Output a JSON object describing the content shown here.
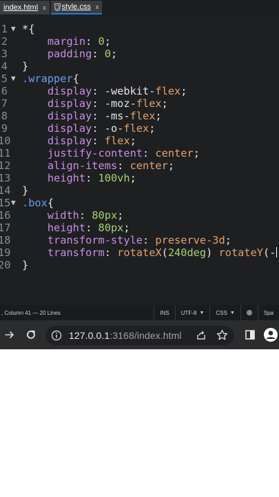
{
  "tabs": [
    {
      "label": "index.html",
      "close": "x",
      "active": false
    },
    {
      "label": "style.css",
      "close": "x",
      "active": true
    }
  ],
  "editor": {
    "lines": [
      {
        "n": "1",
        "fold": "▼",
        "tokens": [
          [
            "t-punc",
            "*{"
          ]
        ]
      },
      {
        "n": "2",
        "fold": "",
        "tokens": [
          [
            "t-punc",
            "    "
          ],
          [
            "t-prop",
            "margin"
          ],
          [
            "t-punc",
            ": "
          ],
          [
            "t-num",
            "0"
          ],
          [
            "t-punc",
            ";"
          ]
        ]
      },
      {
        "n": "3",
        "fold": "",
        "tokens": [
          [
            "t-punc",
            "    "
          ],
          [
            "t-prop",
            "padding"
          ],
          [
            "t-punc",
            ": "
          ],
          [
            "t-num",
            "0"
          ],
          [
            "t-punc",
            ";"
          ]
        ]
      },
      {
        "n": "4",
        "fold": "",
        "tokens": [
          [
            "t-punc",
            "}"
          ]
        ]
      },
      {
        "n": "5",
        "fold": "▼",
        "tokens": [
          [
            "t-sel",
            ".wrapper"
          ],
          [
            "t-punc",
            "{"
          ]
        ]
      },
      {
        "n": "6",
        "fold": "",
        "tokens": [
          [
            "t-punc",
            "    "
          ],
          [
            "t-prop",
            "display"
          ],
          [
            "t-punc",
            ": "
          ],
          [
            "t-punc",
            "-webkit-"
          ],
          [
            "t-val",
            "flex"
          ],
          [
            "t-punc",
            ";"
          ]
        ]
      },
      {
        "n": "7",
        "fold": "",
        "tokens": [
          [
            "t-punc",
            "    "
          ],
          [
            "t-prop",
            "display"
          ],
          [
            "t-punc",
            ": "
          ],
          [
            "t-punc",
            "-moz-"
          ],
          [
            "t-val",
            "flex"
          ],
          [
            "t-punc",
            ";"
          ]
        ]
      },
      {
        "n": "8",
        "fold": "",
        "tokens": [
          [
            "t-punc",
            "    "
          ],
          [
            "t-prop",
            "display"
          ],
          [
            "t-punc",
            ": "
          ],
          [
            "t-punc",
            "-ms-"
          ],
          [
            "t-val",
            "flex"
          ],
          [
            "t-punc",
            ";"
          ]
        ]
      },
      {
        "n": "9",
        "fold": "",
        "tokens": [
          [
            "t-punc",
            "    "
          ],
          [
            "t-prop",
            "display"
          ],
          [
            "t-punc",
            ": "
          ],
          [
            "t-punc",
            "-o-"
          ],
          [
            "t-val",
            "flex"
          ],
          [
            "t-punc",
            ";"
          ]
        ]
      },
      {
        "n": "10",
        "fold": "",
        "tokens": [
          [
            "t-punc",
            "    "
          ],
          [
            "t-prop",
            "display"
          ],
          [
            "t-punc",
            ": "
          ],
          [
            "t-val",
            "flex"
          ],
          [
            "t-punc",
            ";"
          ]
        ]
      },
      {
        "n": "11",
        "fold": "",
        "tokens": [
          [
            "t-punc",
            "    "
          ],
          [
            "t-prop",
            "justify-content"
          ],
          [
            "t-punc",
            ": "
          ],
          [
            "t-val",
            "center"
          ],
          [
            "t-punc",
            ";"
          ]
        ]
      },
      {
        "n": "12",
        "fold": "",
        "tokens": [
          [
            "t-punc",
            "    "
          ],
          [
            "t-prop",
            "align-items"
          ],
          [
            "t-punc",
            ": "
          ],
          [
            "t-val",
            "center"
          ],
          [
            "t-punc",
            ";"
          ]
        ]
      },
      {
        "n": "13",
        "fold": "",
        "tokens": [
          [
            "t-punc",
            "    "
          ],
          [
            "t-prop",
            "height"
          ],
          [
            "t-punc",
            ": "
          ],
          [
            "t-num",
            "100vh"
          ],
          [
            "t-punc",
            ";"
          ]
        ]
      },
      {
        "n": "14",
        "fold": "",
        "tokens": [
          [
            "t-punc",
            "}"
          ]
        ]
      },
      {
        "n": "15",
        "fold": "▼",
        "tokens": [
          [
            "t-sel",
            ".box"
          ],
          [
            "t-punc",
            "{"
          ]
        ]
      },
      {
        "n": "16",
        "fold": "",
        "tokens": [
          [
            "t-punc",
            "    "
          ],
          [
            "t-prop",
            "width"
          ],
          [
            "t-punc",
            ": "
          ],
          [
            "t-num",
            "80px"
          ],
          [
            "t-punc",
            ";"
          ]
        ]
      },
      {
        "n": "17",
        "fold": "",
        "tokens": [
          [
            "t-punc",
            "    "
          ],
          [
            "t-prop",
            "height"
          ],
          [
            "t-punc",
            ": "
          ],
          [
            "t-num",
            "80px"
          ],
          [
            "t-punc",
            ";"
          ]
        ]
      },
      {
        "n": "18",
        "fold": "",
        "tokens": [
          [
            "t-punc",
            "    "
          ],
          [
            "t-prop",
            "transform-style"
          ],
          [
            "t-punc",
            ": "
          ],
          [
            "t-val",
            "preserve-3d"
          ],
          [
            "t-punc",
            ";"
          ]
        ]
      },
      {
        "n": "19",
        "fold": "",
        "tokens": [
          [
            "t-punc",
            "    "
          ],
          [
            "t-prop",
            "transform"
          ],
          [
            "t-punc",
            ": "
          ],
          [
            "t-fn",
            "rotateX"
          ],
          [
            "t-punc",
            "("
          ],
          [
            "t-num",
            "240deg"
          ],
          [
            "t-punc",
            ") "
          ],
          [
            "t-fn",
            "rotateY"
          ],
          [
            "t-punc",
            "(-"
          ],
          [
            "caret",
            ""
          ],
          [
            "t-punc",
            ")"
          ]
        ]
      },
      {
        "n": "20",
        "fold": "",
        "tokens": [
          [
            "t-punc",
            "}"
          ]
        ]
      }
    ]
  },
  "status": {
    "position": ", Column 41 — 20 Lines",
    "ins": "INS",
    "encoding": "UTF-8",
    "language": "CSS",
    "spaces": "Spa",
    "arrow": "▼"
  },
  "browser": {
    "url_host": "127.0.0.1",
    "url_rest": ":3168/index.html"
  },
  "colors": {
    "accent": "#1a7fe0",
    "editor_bg": "#1e1f21",
    "property": "#c98ee6",
    "value": "#e3a36d",
    "number": "#a7d36f",
    "selector": "#6c9ef8"
  }
}
